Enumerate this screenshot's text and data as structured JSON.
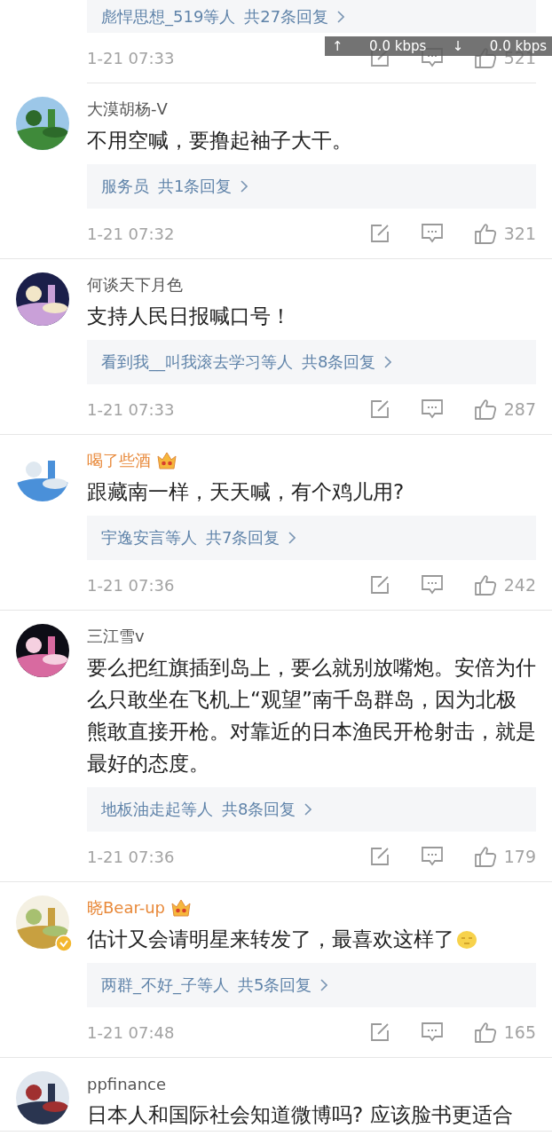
{
  "top_partial": {
    "repliers": "彪悍思想_519等人",
    "reply_count": "共27条回复",
    "time": "1-21 07:33",
    "likes": "521"
  },
  "net_speed": {
    "up_arrow": "↑",
    "up": "0.0 kbps",
    "down_arrow": "↓",
    "down": "0.0 kbps"
  },
  "comments": [
    {
      "name": "大漠胡杨-V",
      "vip": false,
      "verified": false,
      "text": "不用空喊，要撸起袖子大干。",
      "emoji": false,
      "repliers": "服务员",
      "reply_count": "共1条回复",
      "time": "1-21 07:32",
      "likes": "321"
    },
    {
      "name": "何谈天下月色",
      "vip": false,
      "verified": false,
      "text": "支持人民日报喊口号！",
      "emoji": false,
      "repliers": "看到我__叫我滚去学习等人",
      "reply_count": "共8条回复",
      "time": "1-21 07:33",
      "likes": "287"
    },
    {
      "name": "喝了些酒",
      "vip": true,
      "verified": false,
      "text": "跟藏南一样，天天喊，有个鸡儿用?",
      "emoji": false,
      "repliers": "宇逸安言等人",
      "reply_count": "共7条回复",
      "time": "1-21 07:36",
      "likes": "242"
    },
    {
      "name": "三江雪v",
      "vip": false,
      "verified": false,
      "text": "要么把红旗插到岛上，要么就别放嘴炮。安倍为什么只敢坐在飞机上“观望”南千岛群岛，因为北极熊敢直接开枪。对靠近的日本渔民开枪射击，就是最好的态度。",
      "emoji": false,
      "repliers": "地板油走起等人",
      "reply_count": "共8条回复",
      "time": "1-21 07:36",
      "likes": "179"
    },
    {
      "name": "晓Bear-up",
      "vip": true,
      "verified": true,
      "text": "估计又会请明星来转发了，最喜欢这样了",
      "emoji": true,
      "repliers": "两群_不好_子等人",
      "reply_count": "共5条回复",
      "time": "1-21 07:48",
      "likes": "165"
    },
    {
      "name": "ppfinance",
      "vip": false,
      "verified": false,
      "text": "日本人和国际社会知道微博吗? 应该脸书更适合",
      "emoji": false
    }
  ]
}
